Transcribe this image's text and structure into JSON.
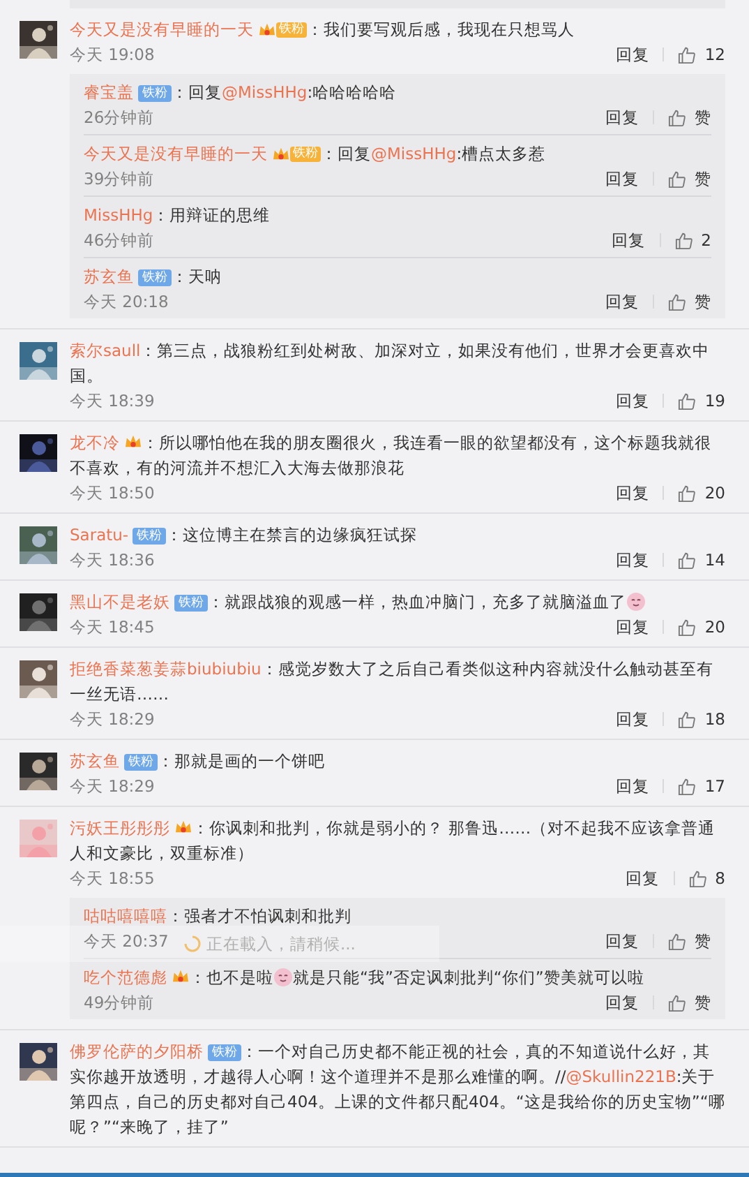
{
  "comments": [
    {
      "user": "今天又是没有早睡的一天",
      "badge": {
        "kind": "gold",
        "label": "铁粉"
      },
      "text": [
        {
          "text": "：我们要写观后感，我现在只想骂人"
        }
      ],
      "time": "今天 19:08",
      "reply": "回复",
      "like": "12",
      "replies": [
        {
          "user": "睿宝盖",
          "badge": {
            "kind": "blue",
            "label": "铁粉"
          },
          "text": [
            {
              "text": "：回复"
            },
            {
              "kind": "mention",
              "text": "@MissHHg"
            },
            {
              "text": ":哈哈哈哈哈"
            }
          ],
          "time": "26分钟前",
          "reply": "回复",
          "like": "赞"
        },
        {
          "user": "今天又是没有早睡的一天",
          "badge": {
            "kind": "gold",
            "label": "铁粉"
          },
          "text": [
            {
              "text": "：回复"
            },
            {
              "kind": "mention",
              "text": "@MissHHg"
            },
            {
              "text": ":槽点太多惹"
            }
          ],
          "time": "39分钟前",
          "reply": "回复",
          "like": "赞"
        },
        {
          "user": "MissHHg",
          "text": [
            {
              "text": "：用辩证的思维"
            }
          ],
          "time": "46分钟前",
          "reply": "回复",
          "like": "2"
        },
        {
          "user": "苏玄鱼",
          "badge": {
            "kind": "blue",
            "label": "铁粉"
          },
          "text": [
            {
              "text": "：天呐"
            }
          ],
          "time": "今天 20:18",
          "reply": "回复",
          "like": "赞"
        }
      ]
    },
    {
      "user": "索尔saull",
      "text": [
        {
          "text": "：第三点，战狼粉红到处树敌、加深对立，如果没有他们，世界才会更喜欢中国。"
        }
      ],
      "time": "今天 18:39",
      "reply": "回复",
      "like": "19"
    },
    {
      "user": "龙不冷",
      "badge": {
        "kind": "crown"
      },
      "text": [
        {
          "text": "：所以哪怕他在我的朋友圈很火，我连看一眼的欲望都没有，这个标题我就很不喜欢，有的河流并不想汇入大海去做那浪花"
        }
      ],
      "time": "今天 18:50",
      "reply": "回复",
      "like": "20"
    },
    {
      "user": "Saratu-",
      "badge": {
        "kind": "blue",
        "label": "铁粉"
      },
      "text": [
        {
          "text": "：这位博主在禁言的边缘疯狂试探"
        }
      ],
      "time": "今天 18:36",
      "reply": "回复",
      "like": "14"
    },
    {
      "user": "黑山不是老妖",
      "badge": {
        "kind": "blue",
        "label": "铁粉"
      },
      "text": [
        {
          "text": "：就跟战狼的观感一样，热血冲脑门，充多了就脑溢血了"
        },
        {
          "kind": "emoji"
        }
      ],
      "time": "今天 18:45",
      "reply": "回复",
      "like": "20"
    },
    {
      "user": "拒绝香菜葱姜蒜biubiubiu",
      "text": [
        {
          "text": "：感觉岁数大了之后自己看类似这种内容就没什么触动甚至有一丝无语……"
        }
      ],
      "time": "今天 18:29",
      "reply": "回复",
      "like": "18"
    },
    {
      "user": "苏玄鱼",
      "badge": {
        "kind": "blue",
        "label": "铁粉"
      },
      "text": [
        {
          "text": "：那就是画的一个饼吧"
        }
      ],
      "time": "今天 18:29",
      "reply": "回复",
      "like": "17"
    },
    {
      "user": "污妖王彤彤彤",
      "badge": {
        "kind": "crown"
      },
      "text": [
        {
          "text": "：你讽刺和批判，你就是弱小的？ 那鲁迅……（对不起我不应该拿普通人和文豪比，双重标准）"
        }
      ],
      "time": "今天 18:55",
      "reply": "回复",
      "like": "8",
      "replies": [
        {
          "user": "咕咕嘻嘻嘻",
          "text": [
            {
              "text": "：强者才不怕讽刺和批判"
            }
          ],
          "time": "今天 20:37",
          "reply": "回复",
          "like": "赞",
          "loading": "正在載入，請稍候..."
        },
        {
          "user": "吃个范德彪",
          "badge": {
            "kind": "crown"
          },
          "text": [
            {
              "text": "：也不是啦"
            },
            {
              "kind": "emoji"
            },
            {
              "text": "就是只能“我”否定讽刺批判“你们”赞美就可以啦"
            }
          ],
          "time": "49分钟前",
          "reply": "回复",
          "like": "赞"
        }
      ]
    },
    {
      "user": "佛罗伦萨的夕阳桥",
      "badge": {
        "kind": "blue",
        "label": "铁粉"
      },
      "text": [
        {
          "text": "：一个对自己历史都不能正视的社会，真的不知道说什么好，其实你越开放透明，才越得人心啊！这个道理并不是那么难懂的啊。//"
        },
        {
          "kind": "mention",
          "text": "@Skullin221B"
        },
        {
          "text": ":关于第四点，自己的历史都对自己404。上课的文件都只配404。“这是我给你的历史宝物”“哪呢？”“来晚了，挂了”"
        }
      ]
    }
  ]
}
